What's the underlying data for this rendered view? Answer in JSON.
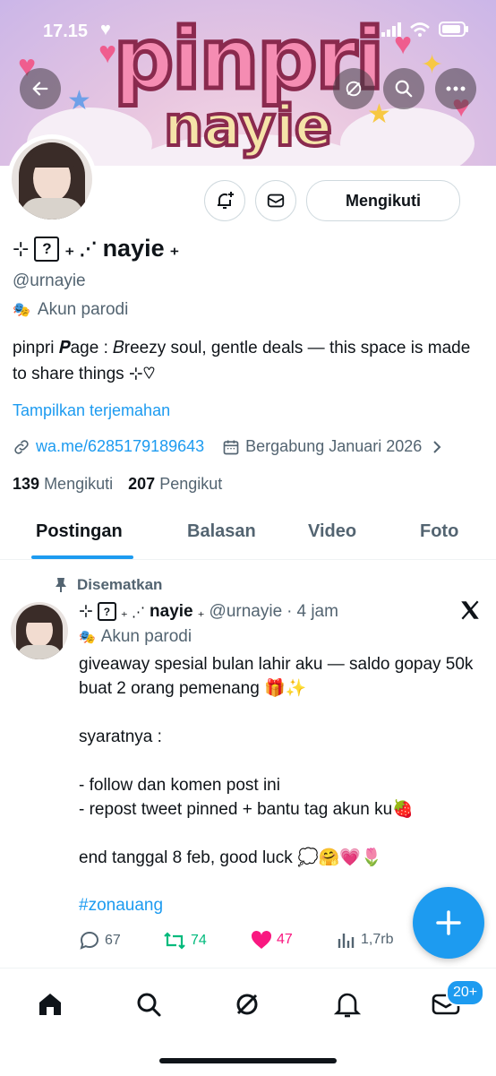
{
  "status_bar": {
    "time": "17.15"
  },
  "banner": {
    "logo_line1": "pinpri",
    "logo_line2": "nayie"
  },
  "profile": {
    "display_name": "nayie",
    "name_prefix": "⊹",
    "name_box_char": "?",
    "name_decor": "₊ ⋰",
    "name_suffix": "₊",
    "handle": "@urnayie",
    "parody_label": "Akun parodi",
    "bio": "pinpri 𝑷age : 𝐵reezy soul, gentle deals — this space is made to share things ⊹♡",
    "translate_label": "Tampilkan terjemahan",
    "link": "wa.me/6285179189643",
    "joined": "Bergabung Januari 2026",
    "following_count": "139",
    "following_label": "Mengikuti",
    "followers_count": "207",
    "followers_label": "Pengikut",
    "follow_button": "Mengikuti"
  },
  "tabs": [
    "Postingan",
    "Balasan",
    "Video",
    "Foto"
  ],
  "post": {
    "pinned_label": "Disematkan",
    "author": "nayie",
    "handle": "@urnayie",
    "time": "4 jam",
    "parody_label": "Akun parodi",
    "text": "giveaway spesial bulan lahir aku — saldo gopay 50k buat 2 orang pemenang 🎁✨\n\nsyaratnya :\n\n- follow dan komen post ini\n- repost tweet pinned + bantu tag akun ku🍓\n\nend tanggal 8 feb, good luck 💭🤗💗🌷",
    "hashtag": "#zonauang",
    "replies": "67",
    "reposts": "74",
    "likes": "47",
    "views": "1,7rb"
  },
  "nav": {
    "badge": "20+"
  },
  "colors": {
    "accent": "#1d9bf0",
    "repost": "#00ba7c",
    "like": "#f91880",
    "text": "#0f1419",
    "muted": "#536471"
  },
  "icons": [
    "back-arrow-icon",
    "grok-icon",
    "search-icon",
    "more-icon",
    "bell-plus-icon",
    "mail-icon",
    "link-icon",
    "calendar-icon",
    "chevron-right-icon",
    "pin-icon",
    "x-logo-icon",
    "reply-icon",
    "repost-icon",
    "heart-icon",
    "views-icon",
    "home-icon",
    "mail-icon",
    "plus-icon"
  ]
}
